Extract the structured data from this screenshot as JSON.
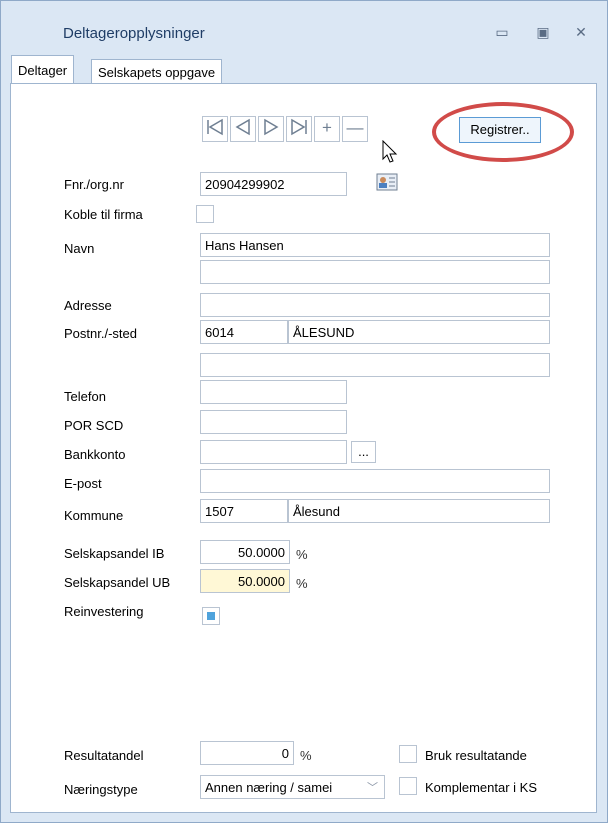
{
  "window": {
    "title": "Deltageropplysninger"
  },
  "tabs": [
    {
      "label": "Deltager"
    },
    {
      "label": "Selskapets oppgave"
    }
  ],
  "nav": {
    "first": "|◁",
    "prev": "◁",
    "next": "▷",
    "last": "▷|",
    "add": "+",
    "remove": "—",
    "register_label": "Registrer.."
  },
  "form": {
    "fnr_label": "Fnr./org.nr",
    "fnr_value": "20904299902",
    "koble_label": "Koble til firma",
    "navn_label": "Navn",
    "navn_value": "Hans Hansen",
    "navn2_value": "",
    "adresse_label": "Adresse",
    "adresse_value": "",
    "postnr_label": "Postnr./-sted",
    "postnr_value": "6014",
    "poststed_value": "ÅLESUND",
    "adresse2_value": "",
    "telefon_label": "Telefon",
    "telefon_value": "",
    "porscd_label": "POR SCD",
    "porscd_value": "",
    "bankkonto_label": "Bankkonto",
    "bankkonto_value": "",
    "bank_btn": "...",
    "epost_label": "E-post",
    "epost_value": "",
    "kommune_label": "Kommune",
    "kommune_nr": "1507",
    "kommune_navn": "Ålesund",
    "andel_ib_label": "Selskapsandel IB",
    "andel_ib_value": "50.0000",
    "andel_ub_label": "Selskapsandel UB",
    "andel_ub_value": "50.0000",
    "pct_symbol": "%",
    "reinvestering_label": "Reinvestering",
    "resultatandel_label": "Resultatandel",
    "resultatandel_value": "0",
    "bruk_label": "Bruk resultatande",
    "naeringstype_label": "Næringstype",
    "naeringstype_value": "Annen næring / samei",
    "komplementar_label": "Komplementar i KS"
  },
  "colors": {
    "window_bg": "#dbe7f4",
    "highlight_field": "#fff8d6",
    "annotation_ring": "#d14b49",
    "checked_fill": "#4fa3dc"
  }
}
